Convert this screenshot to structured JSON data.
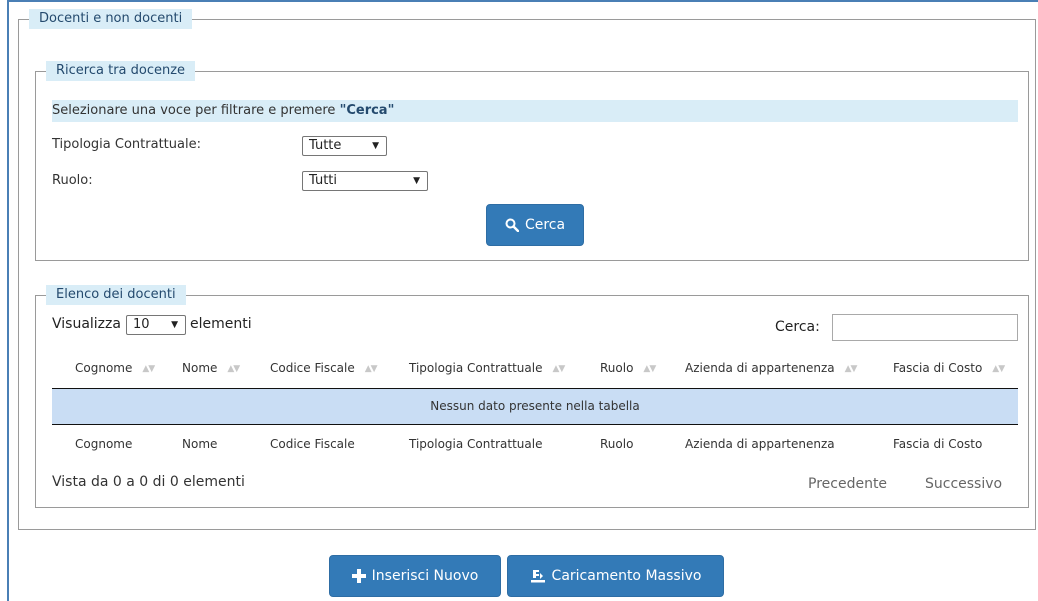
{
  "outer_legend": "Docenti e non docenti",
  "search": {
    "legend": "Ricerca tra docenze",
    "hint_text": "Selezionare una voce per filtrare e premere ",
    "hint_strong": "\"Cerca\"",
    "tipologia_label": "Tipologia Contrattuale:",
    "tipologia_value": "Tutte",
    "ruolo_label": "Ruolo:",
    "ruolo_value": "Tutti",
    "cerca_button": "Cerca"
  },
  "list": {
    "legend": "Elenco dei docenti",
    "show_prefix": "Visualizza",
    "page_length": "10",
    "show_suffix": "elementi",
    "search_label": "Cerca:",
    "search_value": "",
    "columns": [
      "Cognome",
      "Nome",
      "Codice Fiscale",
      "Tipologia Contrattuale",
      "Ruolo",
      "Azienda di appartenenza",
      "Fascia di Costo"
    ],
    "empty_message": "Nessun dato presente nella tabella",
    "info": "Vista da 0 a 0 di 0 elementi",
    "prev": "Precedente",
    "next": "Successivo"
  },
  "actions": {
    "insert": "Inserisci Nuovo",
    "bulk": "Caricamento Massivo"
  },
  "colors": {
    "primary": "#337ab7",
    "legend_bg": "#d9edf7",
    "empty_row": "#c9ddf4"
  }
}
